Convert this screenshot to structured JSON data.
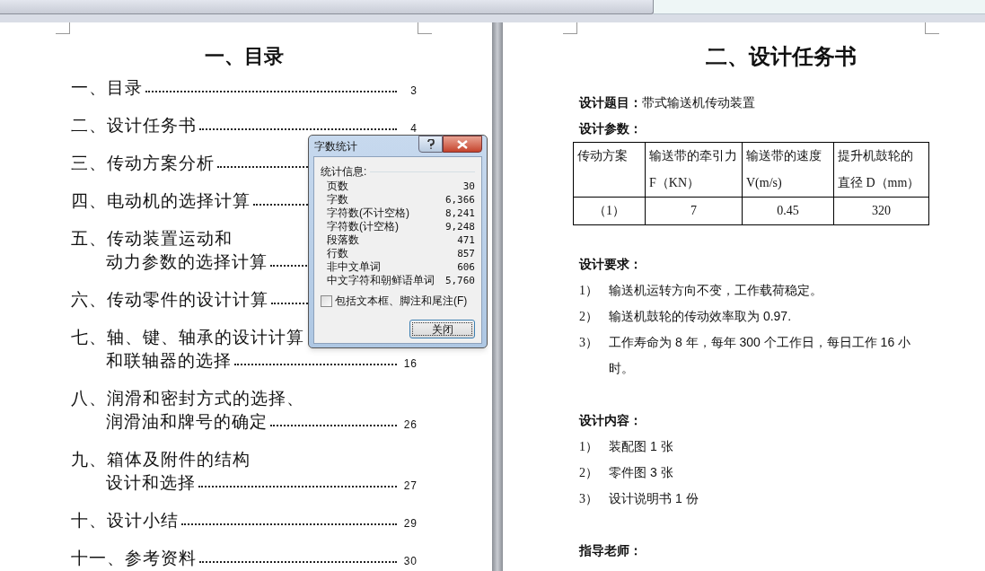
{
  "toc": {
    "title": "一、目录",
    "entries": [
      {
        "lines": [
          "一、目录"
        ],
        "page": "3"
      },
      {
        "lines": [
          "二、设计任务书"
        ],
        "page": "4"
      },
      {
        "lines": [
          "三、传动方案分析"
        ]
      },
      {
        "lines": [
          "四、电动机的选择计算"
        ]
      },
      {
        "lines": [
          "五、传动装置运动和",
          "动力参数的选择计算"
        ]
      },
      {
        "lines": [
          "六、传动零件的设计计算"
        ]
      },
      {
        "lines": [
          "七、轴、键、轴承的设计计算",
          "和联轴器的选择"
        ],
        "page": "16"
      },
      {
        "lines": [
          "八、润滑和密封方式的选择、",
          "润滑油和牌号的确定"
        ],
        "page": "26"
      },
      {
        "lines": [
          "九、箱体及附件的结构",
          "设计和选择"
        ],
        "page": "27"
      },
      {
        "lines": [
          "十、设计小结"
        ],
        "page": "29"
      },
      {
        "lines": [
          "十一、参考资料"
        ],
        "page": "30"
      }
    ]
  },
  "task_page": {
    "title": "二、设计任务书",
    "topic": {
      "label": "设计题目：",
      "value": "带式输送机传动装置"
    },
    "params_heading": "设计参数：",
    "table": {
      "columns": [
        "传动方案",
        "输送带的牵引力 F（KN）",
        "输送带的速度V(m/s)",
        "提升机鼓轮的直径 D（mm）"
      ],
      "rows": [
        [
          "（1）",
          "7",
          "0.45",
          "320"
        ]
      ]
    },
    "requirements": {
      "heading": "设计要求：",
      "items": [
        {
          "number": "1）",
          "text": "输送机运转方向不变，工作载荷稳定。"
        },
        {
          "number": "2）",
          "text": "输送机鼓轮的传动效率取为 0.97."
        },
        {
          "number": "3）",
          "text": "工作寿命为 8 年，每年 300 个工作日，每日工作 16 小时。"
        }
      ]
    },
    "contents": {
      "heading": "设计内容：",
      "items": [
        {
          "number": "1）",
          "text": "装配图 1 张"
        },
        {
          "number": "2）",
          "text": "零件图 3 张"
        },
        {
          "number": "3）",
          "text": "设计说明书 1 份"
        }
      ]
    },
    "advisor_heading": "指导老师："
  },
  "dialog": {
    "title": "字数统计",
    "group_label": "统计信息:",
    "stats": [
      {
        "label": "页数",
        "value": "30"
      },
      {
        "label": "字数",
        "value": "6,366"
      },
      {
        "label": "字符数(不计空格)",
        "value": "8,241"
      },
      {
        "label": "字符数(计空格)",
        "value": "9,248"
      },
      {
        "label": "段落数",
        "value": "471"
      },
      {
        "label": "行数",
        "value": "857"
      },
      {
        "label": "非中文单词",
        "value": "606"
      },
      {
        "label": "中文字符和朝鲜语单词",
        "value": "5,760"
      }
    ],
    "include_checkbox": {
      "label": "包括文本框、脚注和尾注(F)",
      "checked": false
    },
    "close_button": "关闭"
  }
}
